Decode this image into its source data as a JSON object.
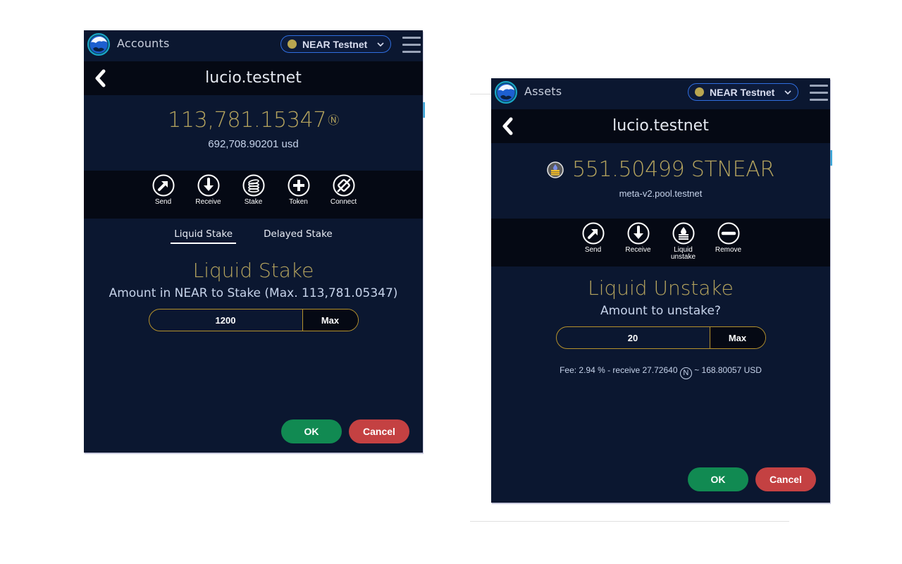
{
  "colors": {
    "panel_bg": "#0b1730",
    "bar_bg": "#050914",
    "gold": "#b5a45e",
    "ok": "#118a52",
    "cancel": "#c44142",
    "network_border": "#2f6ee0",
    "network_dot": "#b9a650"
  },
  "left_panel": {
    "section_title": "Accounts",
    "network": {
      "label": "NEAR Testnet",
      "icon": "chevron-down-icon"
    },
    "account_name": "lucio.testnet",
    "balance": {
      "amount": "113,781.15347",
      "symbol": "Ⓝ",
      "usd": "692,708.90201 usd"
    },
    "actions": [
      {
        "label": "Send",
        "icon": "send-arrow-icon"
      },
      {
        "label": "Receive",
        "icon": "receive-arrow-icon"
      },
      {
        "label": "Stake",
        "icon": "stake-coins-icon"
      },
      {
        "label": "Token",
        "icon": "plus-icon"
      },
      {
        "label": "Connect",
        "icon": "connect-plug-icon"
      }
    ],
    "tabs": [
      {
        "label": "Liquid Stake",
        "active": true
      },
      {
        "label": "Delayed Stake",
        "active": false
      }
    ],
    "form": {
      "title": "Liquid Stake",
      "subtitle": "Amount in NEAR to Stake (Max. 113,781.05347)",
      "amount_value": "1200",
      "max_label": "Max"
    },
    "ok_label": "OK",
    "cancel_label": "Cancel"
  },
  "right_panel": {
    "section_title": "Assets",
    "network": {
      "label": "NEAR Testnet",
      "icon": "chevron-down-icon"
    },
    "account_name": "lucio.testnet",
    "token": {
      "amount": "551.50499 STNEAR",
      "contract": "meta-v2.pool.testnet",
      "icon": "stnear-token-icon"
    },
    "actions": [
      {
        "label": "Send",
        "icon": "send-arrow-icon"
      },
      {
        "label": "Receive",
        "icon": "receive-arrow-icon"
      },
      {
        "label": "Liquid unstake",
        "icon": "liquid-unstake-icon"
      },
      {
        "label": "Remove",
        "icon": "minus-icon"
      }
    ],
    "form": {
      "title": "Liquid Unstake",
      "subtitle": "Amount to unstake?",
      "amount_value": "20",
      "max_label": "Max",
      "fee_prefix": "Fee: 2.94 % - receive 27.72640",
      "fee_symbol": "N",
      "fee_suffix": "~ 168.80057 USD"
    },
    "ok_label": "OK",
    "cancel_label": "Cancel"
  }
}
